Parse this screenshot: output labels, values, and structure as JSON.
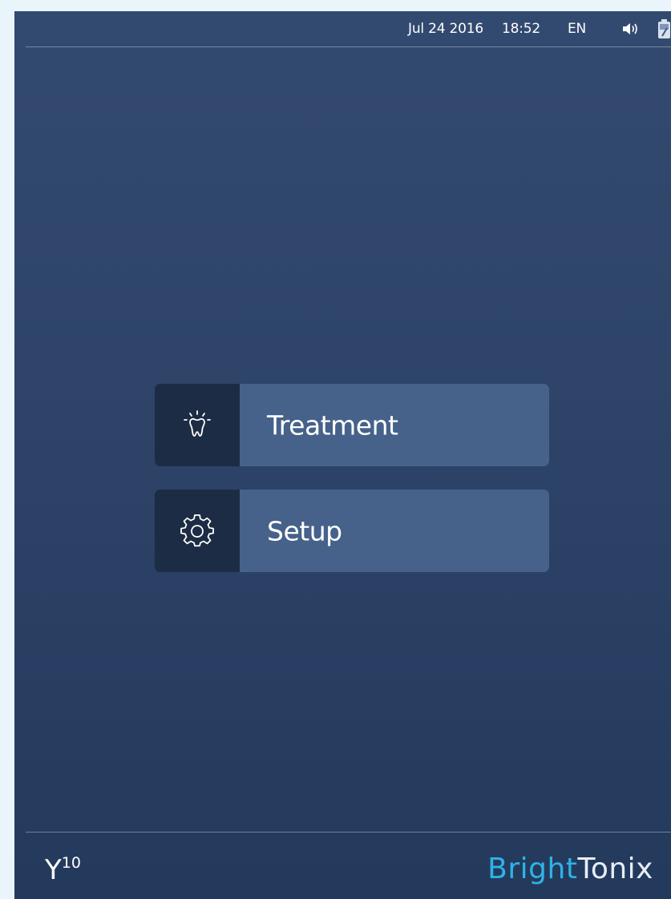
{
  "status_bar": {
    "date": "Jul 24 2016",
    "time": "18:52",
    "language": "EN",
    "volume_icon": "speaker-icon",
    "battery_icon": "battery-icon"
  },
  "menu": {
    "items": [
      {
        "label": "Treatment",
        "icon": "tooth-light-icon"
      },
      {
        "label": "Setup",
        "icon": "gear-icon"
      }
    ]
  },
  "footer": {
    "model_letter": "Y",
    "model_number": "10",
    "brand_part1": "Bright",
    "brand_part2": "Tonix"
  },
  "colors": {
    "background_top": "#334a70",
    "background_bottom": "#243a5c",
    "button_icon_bg": "#1c2c44",
    "button_label_bg": "#46628a",
    "brand_accent": "#2fb2e6"
  }
}
